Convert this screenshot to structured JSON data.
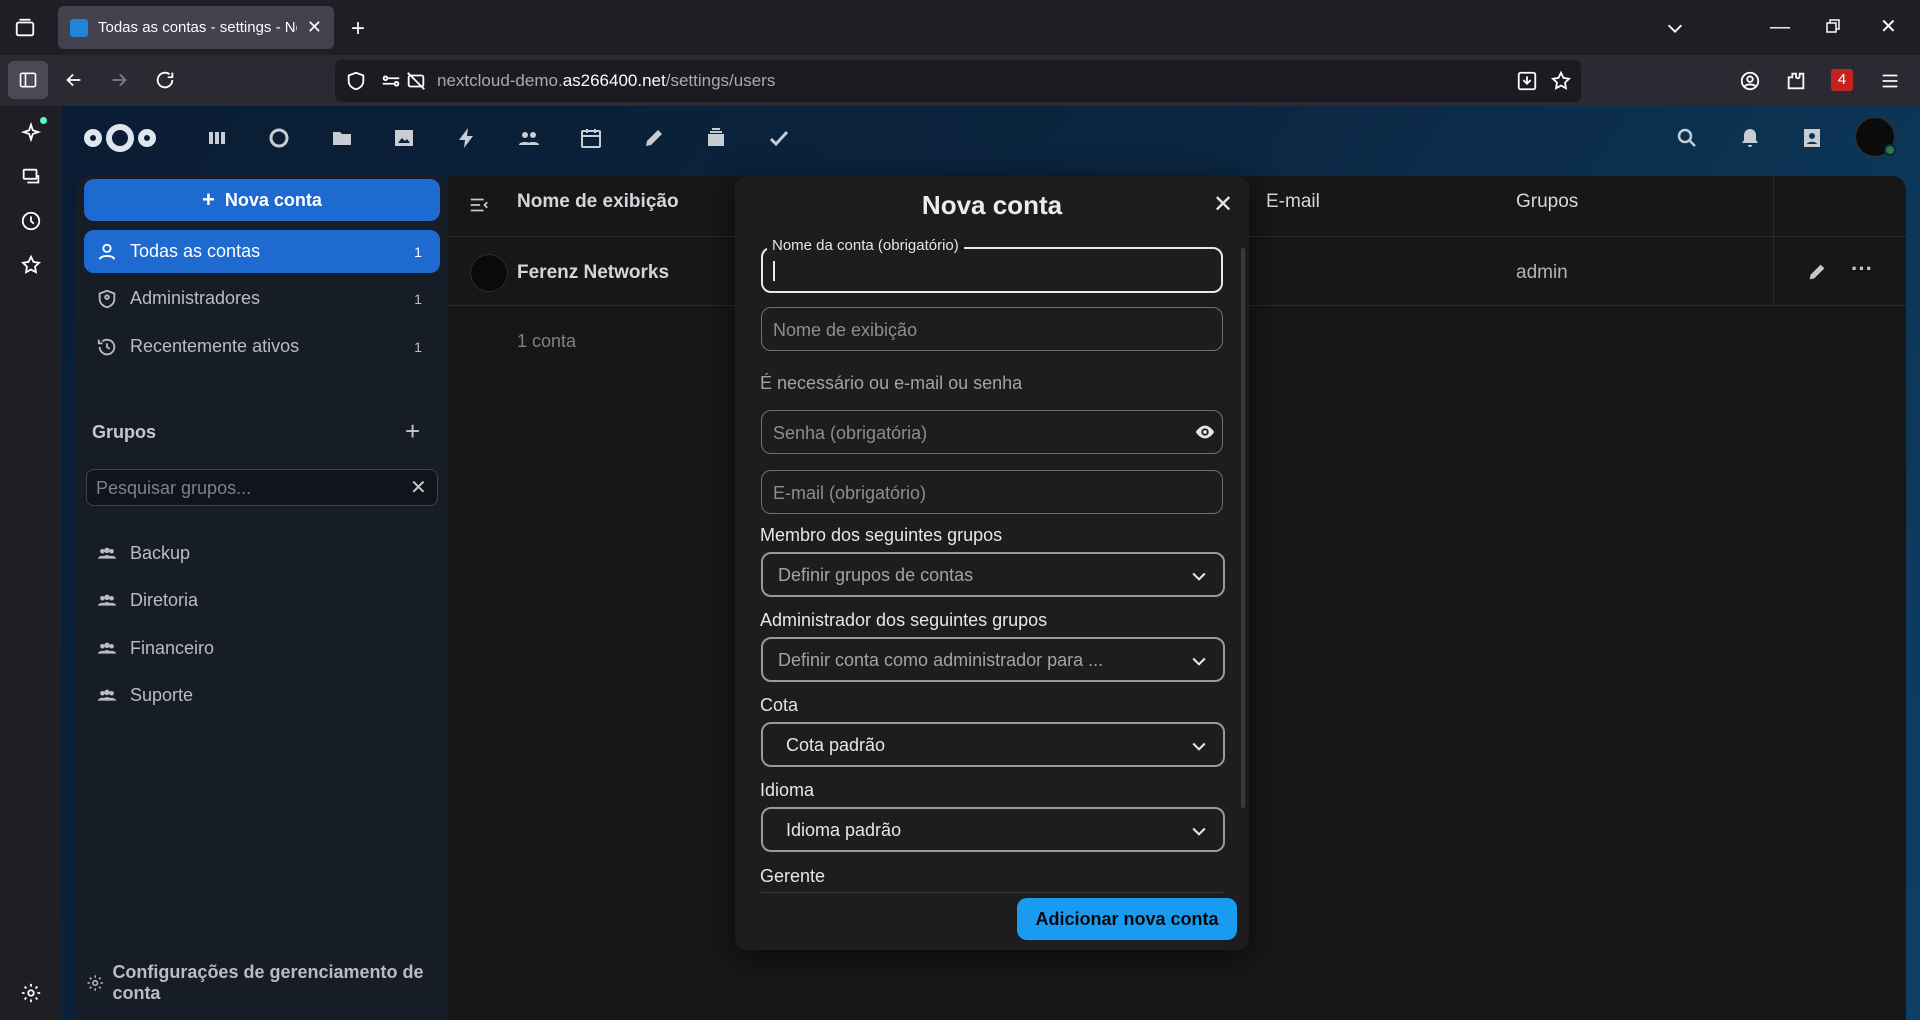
{
  "browser": {
    "tab_title": "Todas as contas - settings - Nextcloud",
    "url_prefix": "nextcloud-demo.",
    "url_domain": "as266400.net",
    "url_path": "/settings/users",
    "extensions_badge": "4"
  },
  "sidebar": {
    "new_account": "Nova conta",
    "items": [
      {
        "label": "Todas as contas",
        "count": "1"
      },
      {
        "label": "Administradores",
        "count": "1"
      },
      {
        "label": "Recentemente ativos",
        "count": "1"
      }
    ],
    "groups_title": "Grupos",
    "search_placeholder": "Pesquisar grupos...",
    "groups": [
      "Backup",
      "Diretoria",
      "Financeiro",
      "Suporte"
    ],
    "settings_label": "Configurações de gerenciamento de conta"
  },
  "table": {
    "headers": {
      "display_name": "Nome de exibição",
      "email": "E-mail",
      "groups": "Grupos"
    },
    "rows": [
      {
        "display_name": "Ferenz Networks",
        "groups": "admin"
      }
    ],
    "count_label": "1 conta"
  },
  "modal": {
    "title": "Nova conta",
    "account_name_label": "Nome da conta (obrigatório)",
    "display_name_placeholder": "Nome de exibição",
    "hint": "É necessário ou e-mail ou senha",
    "password_placeholder": "Senha (obrigatória)",
    "email_placeholder": "E-mail (obrigatório)",
    "member_groups_label": "Membro dos seguintes grupos",
    "member_groups_placeholder": "Definir grupos de contas",
    "admin_groups_label": "Administrador dos seguintes grupos",
    "admin_groups_placeholder": "Definir conta como administrador para ...",
    "quota_label": "Cota",
    "quota_value": "Cota padrão",
    "language_label": "Idioma",
    "language_value": "Idioma padrão",
    "manager_label": "Gerente",
    "submit": "Adicionar nova conta"
  },
  "colors": {
    "primary": "#1e6ad1",
    "submit": "#1a9bf2"
  }
}
